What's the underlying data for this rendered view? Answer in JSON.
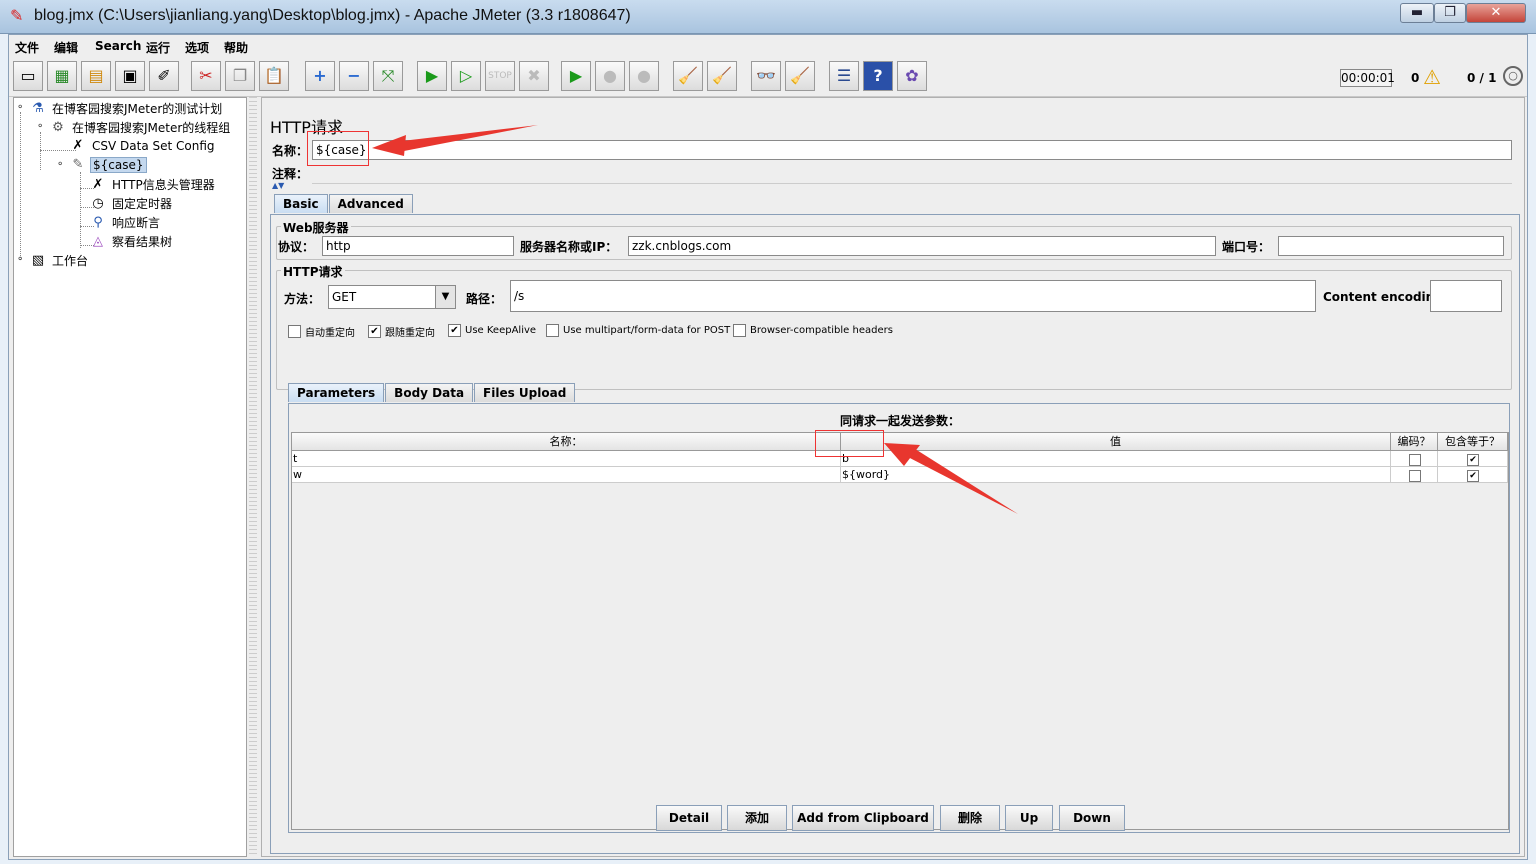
{
  "window": {
    "title": "blog.jmx (C:\\Users\\jianliang.yang\\Desktop\\blog.jmx) - Apache JMeter (3.3 r1808647)",
    "min_glyph": "▬",
    "max_glyph": "❐",
    "close_glyph": "✕"
  },
  "menu": [
    "文件",
    "编辑",
    "Search",
    "运行",
    "选项",
    "帮助"
  ],
  "toolbar": {
    "icons": [
      "new-icon",
      "templates-icon",
      "open-icon",
      "save-icon",
      "save-as-icon",
      "cut-icon",
      "copy-icon",
      "paste-icon",
      "expand-icon",
      "collapse-icon",
      "toggle-icon",
      "start-icon",
      "start-no-timers-icon",
      "stop-icon",
      "shutdown-icon",
      "remote-start-icon",
      "remote-stop-icon",
      "remote-exit-icon",
      "clear-icon",
      "clear-all-icon",
      "search-icon",
      "reset-search-icon",
      "function-helper-icon",
      "help-icon",
      "logger-icon"
    ],
    "timer": "00:00:01",
    "error_count": "0",
    "threads": "0 / 1"
  },
  "tree": {
    "test_plan": "在博客园搜索JMeter的测试计划",
    "thread_group": "在博客园搜索JMeter的线程组",
    "csv": "CSV Data Set Config",
    "sampler": "${case}",
    "header_manager": "HTTP信息头管理器",
    "timer": "固定定时器",
    "assertion": "响应断言",
    "listener": "察看结果树",
    "workbench": "工作台"
  },
  "panel": {
    "title": "HTTP请求",
    "name_label": "名称：",
    "name_value": "${case}",
    "comment_label": "注释：",
    "comment_value": "",
    "tabs": [
      "Basic",
      "Advanced"
    ],
    "web_server": {
      "group_title": "Web服务器",
      "protocol_label": "协议：",
      "protocol_value": "http",
      "server_label": "服务器名称或IP：",
      "server_value": "zzk.cnblogs.com",
      "port_label": "端口号：",
      "port_value": ""
    },
    "http_request": {
      "group_title": "HTTP请求",
      "method_label": "方法：",
      "method_value": "GET",
      "path_label": "路径：",
      "path_value": "/s",
      "encoding_label": "Content encoding:",
      "encoding_value": ""
    },
    "checkboxes": [
      {
        "label": "自动重定向",
        "checked": false
      },
      {
        "label": "跟随重定向",
        "checked": true
      },
      {
        "label": "Use KeepAlive",
        "checked": true
      },
      {
        "label": "Use multipart/form-data for POST",
        "checked": false
      },
      {
        "label": "Browser-compatible headers",
        "checked": false
      }
    ],
    "subtabs": [
      "Parameters",
      "Body Data",
      "Files Upload"
    ],
    "params_caption": "同请求一起发送参数：",
    "columns": [
      "名称：",
      "值",
      "编码？",
      "包含等于？"
    ],
    "rows": [
      {
        "name": "t",
        "value": "b",
        "encode": "",
        "include_equals": "✔"
      },
      {
        "name": "w",
        "value": "${word}",
        "encode": "",
        "include_equals": "✔"
      }
    ],
    "buttons": [
      "Detail",
      "添加",
      "Add from Clipboard",
      "删除",
      "Up",
      "Down"
    ]
  },
  "colors": {
    "annotation_red": "#e8362e",
    "selection": "#c4d8ee",
    "tab_active": "#c9ddf2"
  }
}
